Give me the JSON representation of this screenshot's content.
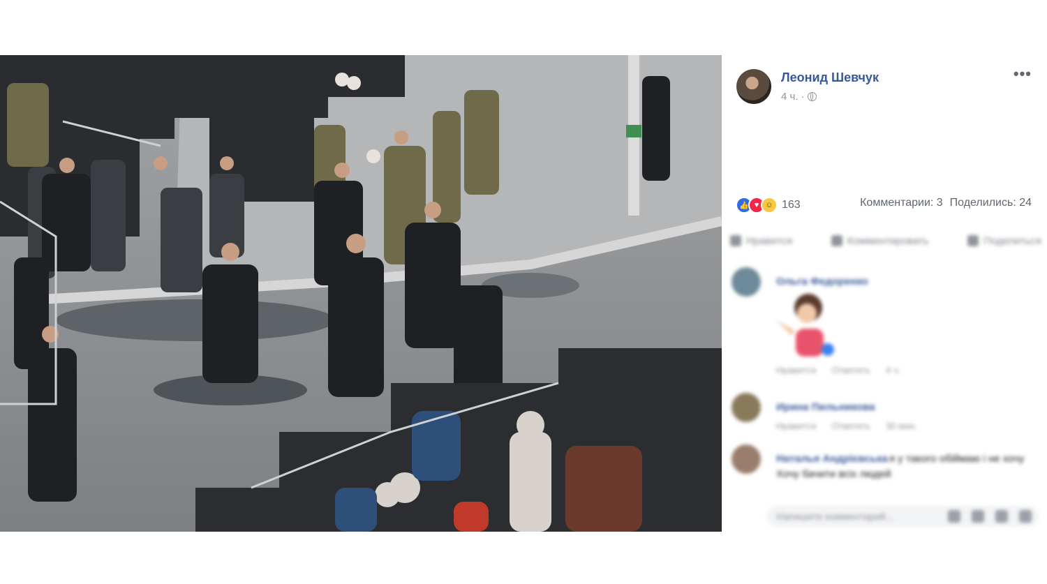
{
  "post": {
    "author": "Леонид Шевчук",
    "time": "4 ч.",
    "time_sep": "·",
    "more": "•••"
  },
  "reactions": {
    "icons": [
      "like-icon",
      "love-icon",
      "haha-icon"
    ],
    "count": "163",
    "comments": "Комментарии: 3",
    "shares": "Поделились: 24"
  },
  "actions": {
    "like": "Нравится",
    "comment": "Комментировать",
    "share": "Поделиться"
  },
  "comments": [
    {
      "name": "Ольга Федоренко",
      "text": "",
      "footer": [
        "Нравится",
        "Ответить",
        "4 ч."
      ]
    },
    {
      "name": "Ирина Пильникова",
      "text": "",
      "footer": [
        "Нравится",
        "Ответить",
        "30 мин."
      ]
    },
    {
      "name": "Наталья Андрієвська",
      "text": "я у такого обіймаю і не хочу",
      "text2": "Хочу бачити всіх людей",
      "footer": []
    }
  ],
  "reply": {
    "placeholder": "Напишите комментарий..."
  },
  "colors": {
    "link": "#385898",
    "muted": "#90949c",
    "like": "#2d6de0",
    "love": "#f0284a",
    "haha": "#f7c844"
  }
}
